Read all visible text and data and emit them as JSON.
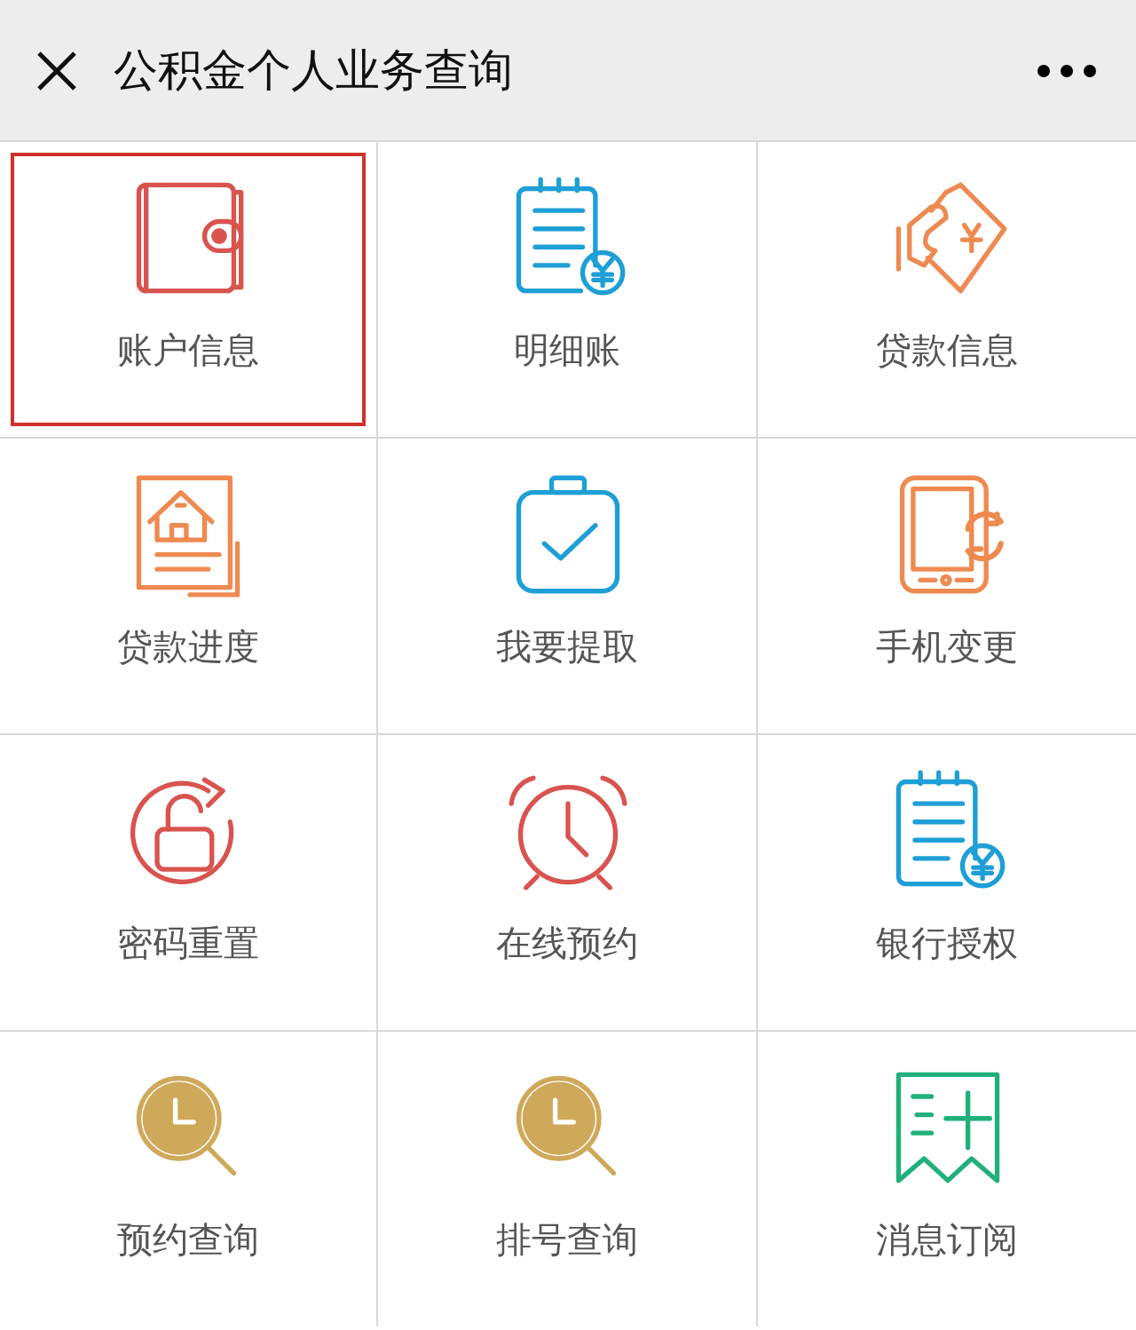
{
  "window": {
    "title": "公积金个人业务查询"
  },
  "tiles": [
    {
      "label": "账户信息",
      "kind": "wallet",
      "color": "#d9534f",
      "selected": true
    },
    {
      "label": "明细账",
      "kind": "ledger",
      "color": "#1e9fd6",
      "selected": false
    },
    {
      "label": "贷款信息",
      "kind": "loan",
      "color": "#ee8a50",
      "selected": false
    },
    {
      "label": "贷款进度",
      "kind": "house",
      "color": "#ee8a50",
      "selected": false
    },
    {
      "label": "我要提取",
      "kind": "clipboard",
      "color": "#1e9fd6",
      "selected": false
    },
    {
      "label": "手机变更",
      "kind": "phone",
      "color": "#ee8a50",
      "selected": false
    },
    {
      "label": "密码重置",
      "kind": "lock",
      "color": "#d9534f",
      "selected": false
    },
    {
      "label": "在线预约",
      "kind": "alarm",
      "color": "#d9534f",
      "selected": false
    },
    {
      "label": "银行授权",
      "kind": "ledger",
      "color": "#1e9fd6",
      "selected": false
    },
    {
      "label": "预约查询",
      "kind": "clocksearch",
      "color": "#cfa95a",
      "selected": false
    },
    {
      "label": "排号查询",
      "kind": "clocksearch",
      "color": "#cfa95a",
      "selected": false
    },
    {
      "label": "消息订阅",
      "kind": "flag",
      "color": "#21b07a",
      "selected": false
    }
  ]
}
